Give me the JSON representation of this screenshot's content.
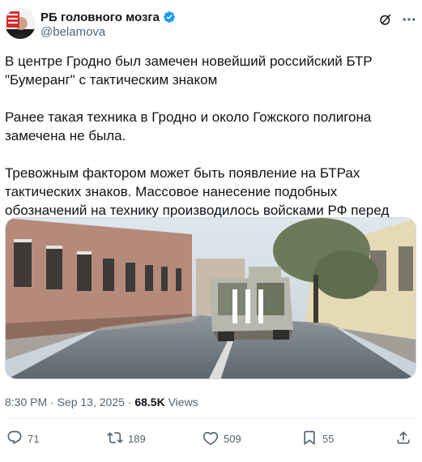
{
  "author": {
    "display_name": "РБ головного мозга",
    "handle": "@belamova",
    "verified": true,
    "avatar_text": "BELARUS"
  },
  "tweet": {
    "paragraphs": [
      "В центре Гродно был замечен новейший российский БТР \"Бумеранг\" с тактическим знаком",
      "Ранее такая техника в Гродно и около Гожского полигона замечена не была.",
      "Тревожным фактором может быть появление на БТРах тактических знаков. Массовое нанесение подобных обозначений на технику производилось войсками РФ перед вторжением в Украину."
    ]
  },
  "meta": {
    "time": "8:30 PM",
    "separator": "·",
    "date": "Sep 13, 2025",
    "views_count": "68.5K",
    "views_label": "Views"
  },
  "actions": {
    "replies": "71",
    "reposts": "189",
    "likes": "509",
    "bookmarks": "55"
  },
  "colors": {
    "text": "#0f1419",
    "secondary": "#536471",
    "verified": "#1d9bf0",
    "divider": "#eff3f4"
  }
}
